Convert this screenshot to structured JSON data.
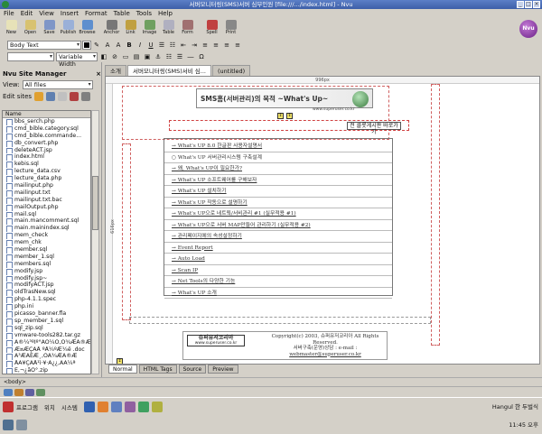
{
  "window": {
    "title": "서버모니터링(SMS)서버 심부인원 [file:///.../index.html] - Nvu"
  },
  "menubar": [
    "File",
    "Edit",
    "View",
    "Insert",
    "Format",
    "Table",
    "Tools",
    "Help"
  ],
  "toolbar": [
    {
      "label": "New",
      "color": "#e7e2b8"
    },
    {
      "label": "Open",
      "color": "#d8c270"
    },
    {
      "label": "Save",
      "color": "#7f96c7"
    },
    {
      "label": "Publish",
      "color": "#9ab0d8"
    },
    {
      "label": "Browse",
      "color": "#5e8fce"
    },
    {
      "label": "Anchor",
      "color": "#777777"
    },
    {
      "label": "Link",
      "color": "#c0a040"
    },
    {
      "label": "Image",
      "color": "#6fa060"
    },
    {
      "label": "Table",
      "color": "#b0b0c0"
    },
    {
      "label": "Form",
      "color": "#a07070"
    },
    {
      "label": "Spell",
      "color": "#c04040"
    },
    {
      "label": "Print",
      "color": "#888888"
    }
  ],
  "format": {
    "paragraph": "Body Text",
    "width": "Variable Width"
  },
  "sidebar": {
    "title": "Nvu Site Manager",
    "view_label": "View:",
    "view_value": "All files",
    "edit_label": "Edit sites",
    "column": "Name",
    "files": [
      "bbs_serch.php",
      "cmd_bible.category.sql",
      "cmd_bible.commande...",
      "db_convert.php",
      "deleteACT.jsp",
      "index.html",
      "kebis.sql",
      "lecture_data.csv",
      "lecture_data.php",
      "mailinput.php",
      "mailinput.txt",
      "mailinput.txt.bac",
      "mailOutput.php",
      "mail.sql",
      "main.mancomment.sql",
      "main.mainindex.sql",
      "mem_check",
      "mem_chk",
      "member.sql",
      "member_1.sql",
      "members.sql",
      "modify.jsp",
      "modify.jsp~",
      "modifyACT.jsp",
      "oldTrasNew.sql",
      "php-4.1.1.spec",
      "php.ini",
      "picasso_banner.fla",
      "sp_member_1.sql",
      "sql_zip.sql",
      "vmware-tools282.tar.gz",
      "Ã®¼³ºÎº°ÁÖ¼Ò,Ó¾ÆÁ®Æ.zip",
      "Æ¤ÆÇÀÅ ºÅ¼ºÆ¼ë .doc",
      "Á³ÆÀÉÆ¸,ÓÀ¾ÆÁ®Æ",
      "ÅÁ¥ÇÁÅ¹ì·¥·À¿¿,ÀÁ¼ª",
      "Ê,¬¿ãÒ°.zip"
    ]
  },
  "tabs": [
    "소개",
    "서버모니터링(SMS)서비 심...",
    "(untitled)"
  ],
  "editor": {
    "ruler": "996px",
    "vruler": "616px",
    "banner_title": "SMS홈(서버관리)의 목적 ~What's Up~",
    "banner_sub": "www.superuser.co.kr",
    "goboard": "전 클롯게시판 바로가기",
    "menu_items": [
      "What's UP 8.0 한글판 사용자설명서",
      "What's UP 서버관리시스템 구축설계",
      "왜, What's UP이 필요한가?",
      "What's UP 소프트웨어를 구해보자",
      "What's UP 설치하기",
      "What's UP 작동으로 설명하기",
      "What's UP으로 네트웍/서비관리 #1 (실무적용 #1)",
      "What's UP으로 서버 MAP만들어 관리하기 (실무적용 #2)",
      "관리페이지에의 속성설정하기",
      "Event Report",
      "Auto Load",
      "Scan IP",
      "Net Tools의 다양한 기능",
      "What's UP 소개"
    ],
    "footer_logo": "슈퍼유저코리아",
    "footer_logo_sub": "www.superuser.co.kr",
    "footer_copy_1": "Copyright(c) 2003, 슈퍼유저코리아 All Rights Reserved.",
    "footer_copy_2": "서버구축(운영)상담 : e-mail :",
    "footer_copy_3": "webmaster@superuser.co.kr"
  },
  "mode_tabs": [
    "Normal",
    "HTML Tags",
    "Source",
    "Preview"
  ],
  "status": "<body>",
  "taskbar": {
    "menu1": "프로그램",
    "menu2": "위치",
    "menu3": "시스템",
    "ime": "Hangul 한 두벌식",
    "clock": "11:45 오후"
  }
}
